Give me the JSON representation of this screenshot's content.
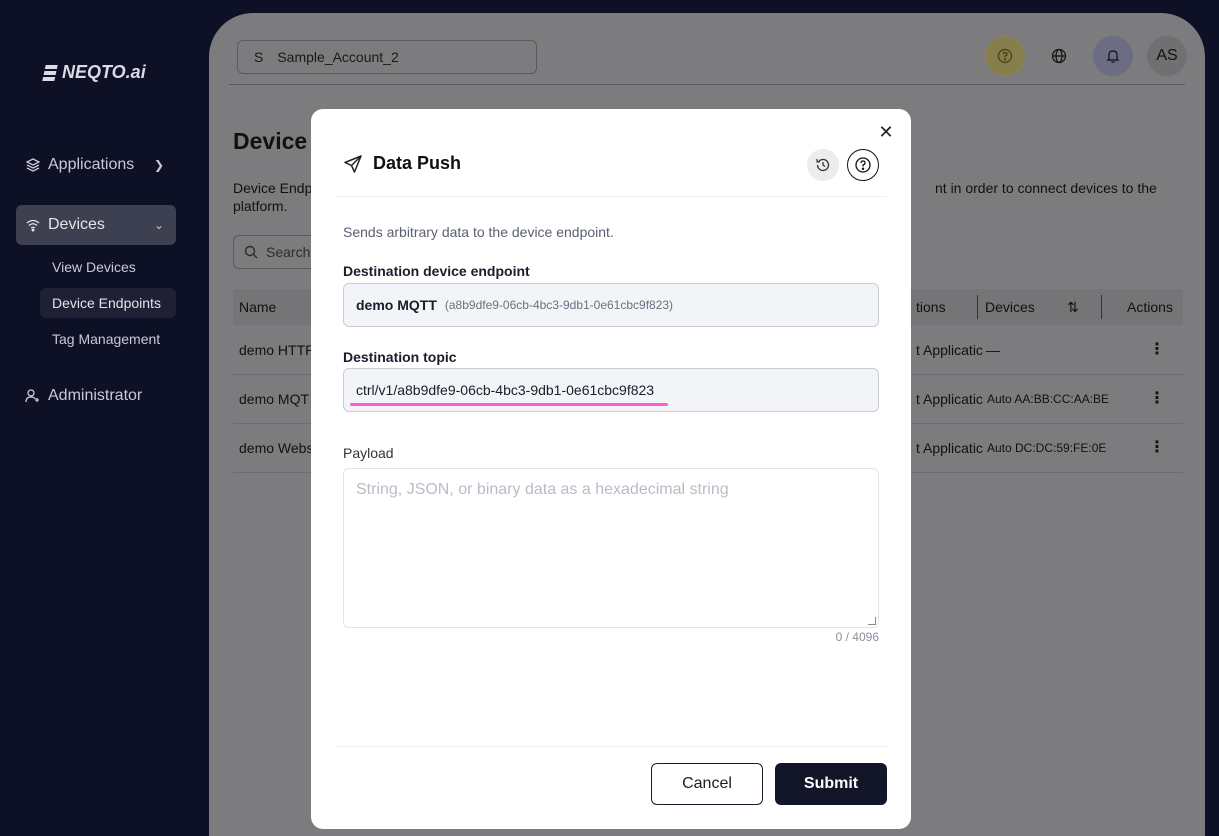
{
  "brand": {
    "name": "NEQTO.ai"
  },
  "sidebar": {
    "items": [
      {
        "label": "Applications",
        "icon": "layers-icon"
      },
      {
        "label": "Devices",
        "icon": "wifi-icon"
      },
      {
        "label": "Administrator",
        "icon": "user-icon"
      }
    ],
    "sub_items": [
      {
        "label": "View Devices"
      },
      {
        "label": "Device Endpoints"
      },
      {
        "label": "Tag Management"
      }
    ]
  },
  "header": {
    "account_initial": "S",
    "account_name": "Sample_Account_2",
    "avatar_initials": "AS"
  },
  "page": {
    "title": "Device",
    "desc_left": "Device Endp",
    "desc_left_2": "platform.",
    "desc_right": "nt in order to connect devices to the",
    "search_placeholder": "Search"
  },
  "table": {
    "headers": {
      "name": "Name",
      "applications": "tions",
      "devices": "Devices",
      "actions": "Actions"
    },
    "rows": [
      {
        "name": "demo HTTP",
        "applications": "t Applicatic",
        "devices": "—"
      },
      {
        "name": "demo MQT",
        "applications": "t Applicatic",
        "devices": "Auto AA:BB:CC:AA:BE"
      },
      {
        "name": "demo Webs",
        "applications": "t Applicatic",
        "devices": "Auto DC:DC:59:FE:0E"
      }
    ]
  },
  "modal": {
    "title": "Data Push",
    "description": "Sends arbitrary data to the device endpoint.",
    "endpoint_label": "Destination device endpoint",
    "endpoint_name": "demo MQTT",
    "endpoint_id": "(a8b9dfe9-06cb-4bc3-9db1-0e61cbc9f823)",
    "topic_label": "Destination topic",
    "topic_value": "ctrl/v1/a8b9dfe9-06cb-4bc3-9db1-0e61cbc9f823",
    "payload_label": "Payload",
    "payload_placeholder": "String, JSON, or binary data as a hexadecimal string",
    "counter": "0 / 4096",
    "cancel_label": "Cancel",
    "submit_label": "Submit"
  },
  "colors": {
    "highlight": "#ff5ad9",
    "primary": "#121628"
  }
}
